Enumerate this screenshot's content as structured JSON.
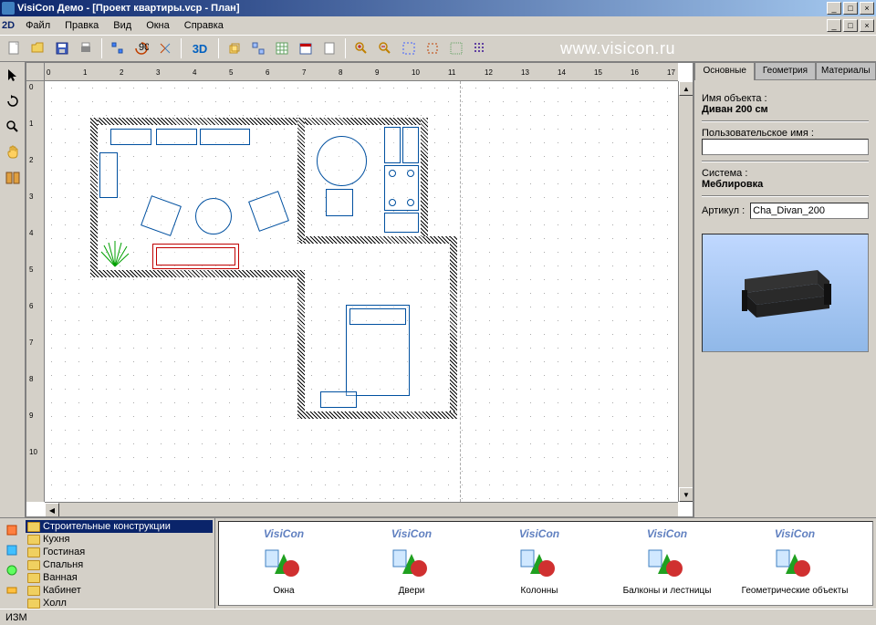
{
  "titlebar": {
    "text": "VisiCon Демо - [Проект квартиры.vcp - План]"
  },
  "menu": {
    "mode2d": "2D",
    "items": [
      "Файл",
      "Правка",
      "Вид",
      "Окна",
      "Справка"
    ]
  },
  "url_watermark": "www.visicon.ru",
  "ruler_h": [
    "0",
    "1",
    "2",
    "3",
    "4",
    "5",
    "6",
    "7",
    "8",
    "9",
    "10",
    "11",
    "12",
    "13",
    "14",
    "15",
    "16",
    "17"
  ],
  "ruler_v": [
    "0",
    "1",
    "2",
    "3",
    "4",
    "5",
    "6",
    "7",
    "8",
    "9",
    "10"
  ],
  "right": {
    "tabs": [
      "Основные",
      "Геометрия",
      "Материалы"
    ],
    "prop_name_label": "Имя объекта :",
    "prop_name_value": "Диван 200 см",
    "user_name_label": "Пользовательское имя :",
    "user_name_value": "",
    "system_label": "Система :",
    "system_value": "Меблировка",
    "article_label": "Артикул :",
    "article_value": "Cha_Divan_200"
  },
  "tree": {
    "items": [
      "Строительные конструкции",
      "Кухня",
      "Гостиная",
      "Спальня",
      "Ванная",
      "Кабинет",
      "Холл"
    ]
  },
  "catalog": {
    "brand": "VisiCon",
    "items": [
      "Окна",
      "Двери",
      "Колонны",
      "Балконы и лестницы",
      "Геометрические объекты"
    ]
  },
  "status": {
    "text": "ИЗМ"
  }
}
